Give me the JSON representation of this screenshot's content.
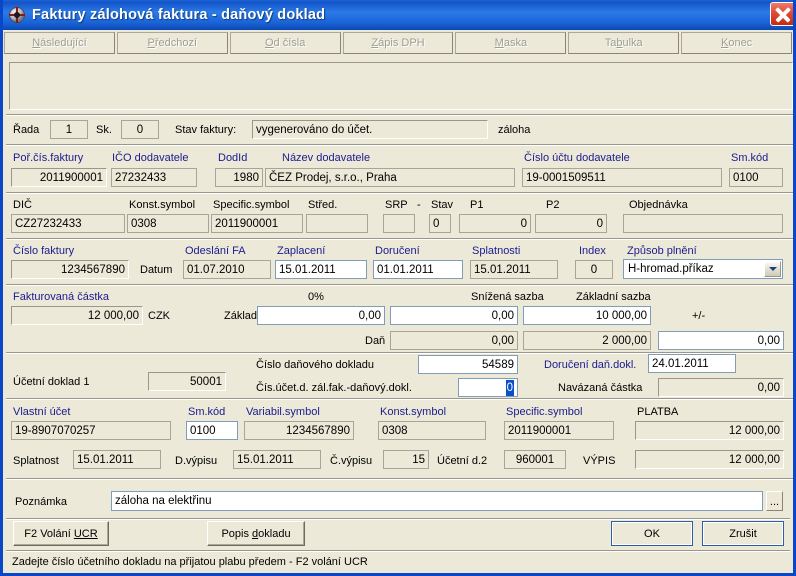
{
  "window": {
    "title": "Faktury zálohová faktura - daňový doklad",
    "icon": "app-wheel-icon",
    "close_label": "×",
    "accent_titlebar": "#1b63d6",
    "face_color": "#ece9d8"
  },
  "toolbar": {
    "buttons": [
      {
        "name": "nasledujici",
        "label": "Následující",
        "accel": "N"
      },
      {
        "name": "predchozi",
        "label": "Předchozí",
        "accel": "P"
      },
      {
        "name": "od-cisla",
        "label": "Od čísla",
        "accel": "O"
      },
      {
        "name": "zapis-dph",
        "label": "Zápis DPH",
        "accel": "Z"
      },
      {
        "name": "maska",
        "label": "Maska",
        "accel": "M"
      },
      {
        "name": "tabulka",
        "label": "Tabulka",
        "accel": "b"
      },
      {
        "name": "konec",
        "label": "Konec",
        "accel": "K"
      }
    ]
  },
  "row_series": {
    "rada_label": "Řada",
    "rada_value": "1",
    "sk_label": "Sk.",
    "sk_value": "0",
    "stav_faktury_label": "Stav faktury:",
    "stav_faktury_value": "vygenerováno do účet.",
    "zaloha_label": "záloha"
  },
  "row_supplier": {
    "por_cis_faktury_label": "Poř.čís.faktury",
    "por_cis_faktury_value": "2011900001",
    "ico_label": "IČO dodavatele",
    "ico_value": "27232433",
    "dodid_label": "DodId",
    "dodid_value": "1980",
    "nazev_label": "Název dodavatele",
    "nazev_value": "ČEZ Prodej, s.r.o., Praha",
    "cislo_uctu_label": "Číslo účtu  dodavatele",
    "cislo_uctu_value": "19-0001509511",
    "sm_kod_label": "Sm.kód",
    "sm_kod_value": "0100"
  },
  "row_vat": {
    "dic_label": "DIČ",
    "dic_value": "CZ27232433",
    "konst_symbol_label": "Konst.symbol",
    "konst_symbol_value": "0308",
    "specific_symbol_label": "Specific.symbol",
    "specific_symbol_value": "2011900001",
    "stred_label": "Střed.",
    "stred_value": "",
    "srp_label": "SRP",
    "srp_dash": "-",
    "srp_value": "",
    "stav_label": "Stav",
    "stav_value": "0",
    "p1_label": "P1",
    "p1_value": "0",
    "p2_label": "P2",
    "p2_value": "0",
    "objednavka_label": "Objednávka",
    "objednavka_value": ""
  },
  "row_dates": {
    "cislo_faktury_label": "Číslo faktury",
    "cislo_faktury_value": "1234567890",
    "datum_label": "Datum",
    "odeslani_fa_label": "Odeslání FA",
    "odeslani_fa_value": "01.07.2010",
    "zaplaceni_label": "Zaplacení",
    "zaplaceni_value": "15.01.2011",
    "doruceni_label": "Doručení",
    "doruceni_value": "01.01.2011",
    "splatnosti_label": "Splatnosti",
    "splatnosti_value": "15.01.2011",
    "index_label": "Index",
    "index_value": "0",
    "zpusob_plneni_label": "Způsob plnění",
    "zpusob_plneni_value": "H-hromad.příkaz"
  },
  "row_amounts": {
    "fakturovana_castka_label": "Fakturovaná částka",
    "fakturovana_castka_value": "12 000,00",
    "currency": "CZK",
    "zaklad_label": "Základ",
    "dan_label": "Daň",
    "rate0_label": "0%",
    "rate0_base": "0,00",
    "rate0_tax": "0,00",
    "snizena_sazba_label": "Snížená sazba",
    "snizena_base": "0,00",
    "snizena_tax": "0,00",
    "zakladni_sazba_label": "Základní sazba",
    "zakladni_base": "10 000,00",
    "zakladni_tax": "2 000,00",
    "plusminus_label": "+/-",
    "plusminus_value": "0,00"
  },
  "row_doc": {
    "ucetni_doklad_label": "Účetní doklad 1",
    "ucetni_doklad_value": "50001",
    "cislo_dan_dokladu_label": "Číslo daňového dokladu",
    "cislo_dan_dokladu_value": "54589",
    "doruceni_dan_dokl_label": "Doručení daň.dokl.",
    "doruceni_dan_dokl_value": "24.01.2011",
    "cis_ucet_zal_label": "Čís.účet.d. zál.fak.-daňový.dokl.",
    "cis_ucet_zal_value": "0",
    "navazana_castka_label": "Navázaná částka",
    "navazana_castka_value": "0,00"
  },
  "row_payment": {
    "vlastni_ucet_label": "Vlastní účet",
    "vlastni_ucet_value": "19-8907070257",
    "sm_kod_label": "Sm.kód",
    "sm_kod_value": "0100",
    "variabil_symbol_label": "Variabil.symbol",
    "variabil_symbol_value": "1234567890",
    "konst_symbol_label": "Konst.symbol",
    "konst_symbol_value": "0308",
    "specific_symbol_label": "Specific.symbol",
    "specific_symbol_value": "2011900001",
    "platba_label": "PLATBA",
    "platba_value": "12 000,00",
    "splatnost_label": "Splatnost",
    "splatnost_value": "15.01.2011",
    "d_vypisu_label": "D.výpisu",
    "d_vypisu_value": "15.01.2011",
    "c_vypisu_label": "Č.výpisu",
    "c_vypisu_value": "15",
    "ucetni_d2_label": "Účetní d.2",
    "ucetni_d2_value": "960001",
    "vypis_label": "VÝPIS",
    "vypis_value": "12 000,00"
  },
  "row_note": {
    "poznamka_label": "Poznámka",
    "poznamka_value": "záloha na elektřinu",
    "browse_label": "..."
  },
  "footer": {
    "f2_label_pre": "F2 Volání ",
    "f2_label_accel": "UCR",
    "popis_label_pre": "Popis ",
    "popis_label_accel": "d",
    "popis_label_post": "okladu",
    "ok_label": "OK",
    "cancel_label": "Zrušit"
  },
  "statusbar": {
    "text": "Zadejte číslo účetního dokladu na přijatou plabu předem  -  F2 volání UCR"
  }
}
